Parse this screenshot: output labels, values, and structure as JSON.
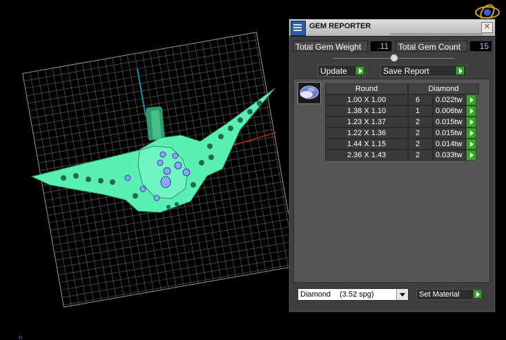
{
  "window": {
    "title": "GEM REPORTER",
    "close_glyph": "✕"
  },
  "totals": {
    "weight_label": "Total Gem Weight",
    "weight_value": ".11",
    "count_label": "Total Gem Count",
    "count_value": "15"
  },
  "slider": {
    "level": 0.5
  },
  "actions": {
    "update_label": "Update",
    "save_label": "Save Report"
  },
  "table": {
    "shape": "Round",
    "material": "Diamond",
    "rows": [
      {
        "size": "1.00 X 1.00",
        "count": "6",
        "weight": "0.022tw"
      },
      {
        "size": "1.38 X 1.10",
        "count": "1",
        "weight": "0.006tw"
      },
      {
        "size": "1.23 X 1.37",
        "count": "2",
        "weight": "0.015tw"
      },
      {
        "size": "1.22 X 1.36",
        "count": "2",
        "weight": "0.015tw"
      },
      {
        "size": "1.44 X 1.15",
        "count": "2",
        "weight": "0.014tw"
      },
      {
        "size": "2.36 X 1.43",
        "count": "2",
        "weight": "0.033tw"
      }
    ]
  },
  "material_select": {
    "name": "Diamond",
    "spg": "(3.52 spg)"
  },
  "set_material_label": "Set Material",
  "icons": {
    "gizmo": "orbit-gizmo-icon",
    "title": "report-icon",
    "thumb": "round-gem-icon",
    "go": "green-play-icon"
  },
  "colors": {
    "model": "#5af0b4",
    "grid": "#9a9a9a",
    "axis_y": "#1e90b0",
    "axis_x": "#c0201e",
    "accent_green": "#37a22c",
    "value_text": "#8fd0ff"
  }
}
